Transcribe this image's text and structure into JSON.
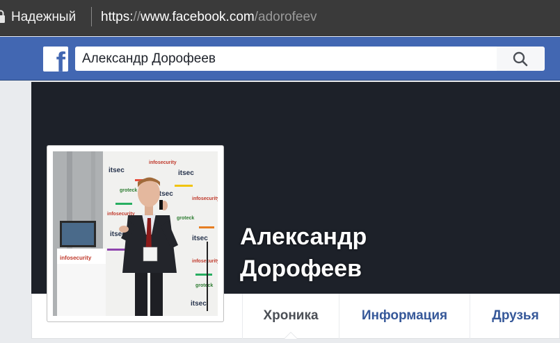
{
  "browser": {
    "secure_label": "Надежный",
    "url_scheme": "https:",
    "url_slashes": "//",
    "url_host": "www.facebook.com",
    "url_path": "/adorofeev"
  },
  "header": {
    "logo_letter": "f",
    "search_value": "Александр Дорофеев",
    "brand_color": "#4267b2"
  },
  "profile": {
    "name": "Александр Дорофеев",
    "photo_banner_texts": [
      "itsec",
      "infosecurity",
      "groteck"
    ]
  },
  "tabs": [
    {
      "label": "Хроника",
      "active": true
    },
    {
      "label": "Информация",
      "active": false
    },
    {
      "label": "Друзья",
      "active": false
    }
  ],
  "icons": {
    "lock": "lock-icon",
    "search": "search-icon",
    "logo": "facebook-logo-icon"
  }
}
